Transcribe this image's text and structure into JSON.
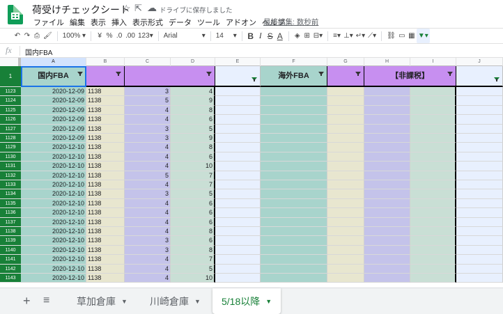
{
  "titlebar": {
    "title": "荷受けチェックシート",
    "star_icon": "☆",
    "move_icon": "⇱",
    "cloud_icon": "☁",
    "saved_status": "ドライブに保存しました",
    "last_edit": "最終編集: 数秒前"
  },
  "menu": [
    "ファイル",
    "編集",
    "表示",
    "挿入",
    "表示形式",
    "データ",
    "ツール",
    "アドオン",
    "ヘルプ"
  ],
  "toolbar": {
    "zoom": "100%",
    "currency": "¥",
    "percent": "%",
    "dec_less": ".0",
    "dec_more": ".00",
    "more_formats": "123",
    "font": "Arial",
    "font_size": "14",
    "bold": "B",
    "italic": "I",
    "strike": "S",
    "text_color": "A"
  },
  "formula_bar": {
    "fx": "fx",
    "content": "国内FBA"
  },
  "columns": [
    "A",
    "B",
    "C",
    "D",
    "E",
    "F",
    "G",
    "H",
    "I",
    "J"
  ],
  "header_row": {
    "row_number": "1",
    "a": "国内FBA",
    "f": "海外FBA",
    "h": "【非課税】"
  },
  "rows": [
    {
      "n": "1123",
      "date": "2020-12-09",
      "code": "1138",
      "c": "3",
      "d": "4"
    },
    {
      "n": "1124",
      "date": "2020-12-09",
      "code": "1138",
      "c": "5",
      "d": "9"
    },
    {
      "n": "1125",
      "date": "2020-12-09",
      "code": "1138",
      "c": "4",
      "d": "8"
    },
    {
      "n": "1126",
      "date": "2020-12-09",
      "code": "1138",
      "c": "4",
      "d": "6"
    },
    {
      "n": "1127",
      "date": "2020-12-09",
      "code": "1138",
      "c": "3",
      "d": "5"
    },
    {
      "n": "1128",
      "date": "2020-12-09",
      "code": "1138",
      "c": "3",
      "d": "9"
    },
    {
      "n": "1129",
      "date": "2020-12-10",
      "code": "1138",
      "c": "4",
      "d": "8"
    },
    {
      "n": "1130",
      "date": "2020-12-10",
      "code": "1138",
      "c": "4",
      "d": "6"
    },
    {
      "n": "1131",
      "date": "2020-12-10",
      "code": "1138",
      "c": "4",
      "d": "10"
    },
    {
      "n": "1132",
      "date": "2020-12-10",
      "code": "1138",
      "c": "5",
      "d": "7"
    },
    {
      "n": "1133",
      "date": "2020-12-10",
      "code": "1138",
      "c": "4",
      "d": "7"
    },
    {
      "n": "1134",
      "date": "2020-12-10",
      "code": "1138",
      "c": "3",
      "d": "5"
    },
    {
      "n": "1135",
      "date": "2020-12-10",
      "code": "1138",
      "c": "4",
      "d": "6"
    },
    {
      "n": "1136",
      "date": "2020-12-10",
      "code": "1138",
      "c": "4",
      "d": "6"
    },
    {
      "n": "1137",
      "date": "2020-12-10",
      "code": "1138",
      "c": "4",
      "d": "6"
    },
    {
      "n": "1138",
      "date": "2020-12-10",
      "code": "1138",
      "c": "4",
      "d": "8"
    },
    {
      "n": "1139",
      "date": "2020-12-10",
      "code": "1138",
      "c": "3",
      "d": "6"
    },
    {
      "n": "1140",
      "date": "2020-12-10",
      "code": "1138",
      "c": "3",
      "d": "8"
    },
    {
      "n": "1141",
      "date": "2020-12-10",
      "code": "1138",
      "c": "4",
      "d": "7"
    },
    {
      "n": "1142",
      "date": "2020-12-10",
      "code": "1138",
      "c": "4",
      "d": "5"
    },
    {
      "n": "1143",
      "date": "2020-12-10",
      "code": "1138",
      "c": "4",
      "d": "10"
    }
  ],
  "sheets": {
    "add": "+",
    "list": "≡",
    "tabs": [
      "草加倉庫",
      "川崎倉庫",
      "5/18以降"
    ],
    "active_index": 2
  },
  "colors": {
    "brand_green": "#188038",
    "col_a": "#a8d4cc",
    "col_b": "#e8e6cf",
    "col_c": "#c4c3ea",
    "col_d": "#c9dfd5",
    "col_e": "#e8f0fe",
    "col_f": "#a8d4cc",
    "col_g": "#e8e6cf",
    "col_h": "#c4c3ea",
    "col_i": "#c9dfd5",
    "col_j": "#e8f0fe",
    "header_purple": "#c78ff0"
  }
}
